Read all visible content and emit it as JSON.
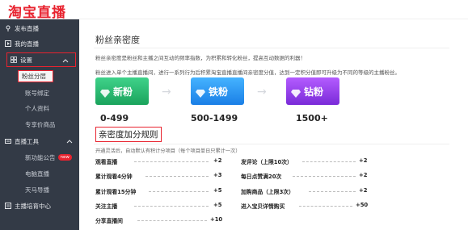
{
  "header": {
    "logo": "淘宝直播"
  },
  "sidebar": {
    "items": [
      {
        "label": "发布直播",
        "icon": "broadcast-icon"
      },
      {
        "label": "我的直播",
        "icon": "live-icon"
      },
      {
        "label": "设置",
        "icon": "grid-icon"
      },
      {
        "label": "粉丝分层"
      },
      {
        "label": "账号绑定"
      },
      {
        "label": "个人资料"
      },
      {
        "label": "专享价商品"
      },
      {
        "label": "直播工具",
        "icon": "tools-icon"
      },
      {
        "label": "新功能公告",
        "badge": "new"
      },
      {
        "label": "电脑直播"
      },
      {
        "label": "天马导播"
      },
      {
        "label": "主播培育中心",
        "icon": "training-icon"
      }
    ]
  },
  "main": {
    "title": "粉丝亲密度",
    "desc1": "粉丝亲密度是粉丝和主播之间互动的频率指数，为积累和转化粉丝，提高互动数据的利器！",
    "desc2": "粉丝进入单个主播直播间，进行一系列行为后积累淘宝直播直播间亲密度分值，达到一定积分值即可升级为不同的等级的主播粉丝。",
    "levels": [
      {
        "name": "新粉",
        "range": "0-499",
        "color": "#22b86c"
      },
      {
        "name": "铁粉",
        "range": "500-1499",
        "color": "#2b95f5"
      },
      {
        "name": "钻粉",
        "range": "1500+",
        "color": "#9a44ef"
      }
    ],
    "rules_title": "亲密度加分规则",
    "rules_desc": "开通灵活后，自动默认有积计分项目（每个项目单日只累计一次）",
    "rules_left": [
      {
        "label": "观看直播",
        "points": "+2"
      },
      {
        "label": "累计观看4分钟",
        "points": "+3"
      },
      {
        "label": "累计观看15分钟",
        "points": "+5"
      },
      {
        "label": "关注主播",
        "points": "+5"
      },
      {
        "label": "分享直播间",
        "points": "+10"
      }
    ],
    "rules_right": [
      {
        "label": "发评论（上限10次）",
        "points": "+2"
      },
      {
        "label": "每日点赞满20次",
        "points": "+2"
      },
      {
        "label": "加购商品（上限3次）",
        "points": "+2"
      },
      {
        "label": "进入宝贝详情购买",
        "points": "+50"
      }
    ]
  },
  "colors": {
    "brand": "#e8232f",
    "sidebar_bg": "#333a46"
  }
}
